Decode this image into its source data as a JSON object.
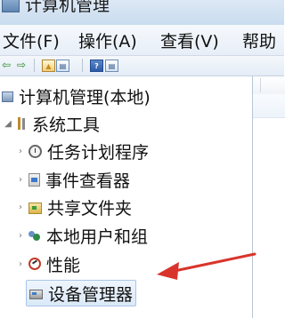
{
  "window": {
    "title": "计算机管理"
  },
  "menubar": {
    "items": [
      {
        "label": "文件(F)"
      },
      {
        "label": "操作(A)"
      },
      {
        "label": "查看(V)"
      },
      {
        "label": "帮助"
      }
    ]
  },
  "toolbar": {
    "icons": [
      "back-arrow-icon",
      "forward-arrow-icon",
      "up-level-icon",
      "show-hide-tree-icon",
      "help-icon",
      "properties-icon"
    ]
  },
  "tree": {
    "root": {
      "label": "计算机管理(本地)"
    },
    "system_tools": {
      "label": "系统工具"
    },
    "items": [
      {
        "label": "任务计划程序",
        "icon": "task-scheduler-icon"
      },
      {
        "label": "事件查看器",
        "icon": "event-viewer-icon"
      },
      {
        "label": "共享文件夹",
        "icon": "shared-folders-icon"
      },
      {
        "label": "本地用户和组",
        "icon": "local-users-groups-icon"
      },
      {
        "label": "性能",
        "icon": "performance-icon"
      },
      {
        "label": "设备管理器",
        "icon": "device-manager-icon",
        "selected": true
      }
    ]
  },
  "annotation": {
    "arrow_color": "#d9342b"
  }
}
